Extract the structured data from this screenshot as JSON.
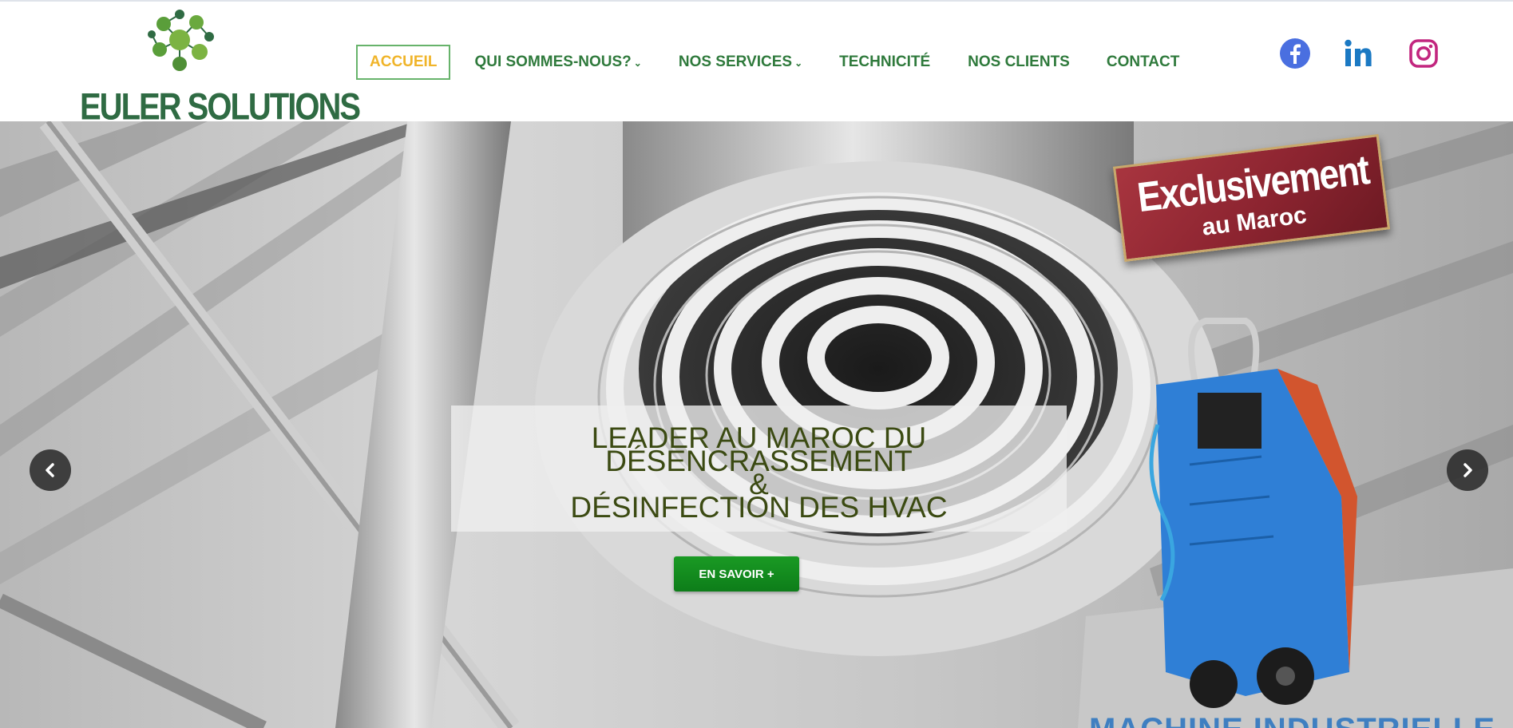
{
  "brand": {
    "name": "EULER SOLUTIONS",
    "color": "#2f6b43",
    "accent": "#f0b429"
  },
  "nav": {
    "items": [
      {
        "label": "ACCUEIL",
        "active": true
      },
      {
        "label": "QUI SOMMES-NOUS?",
        "has_dropdown": true
      },
      {
        "label": "NOS SERVICES",
        "has_dropdown": true
      },
      {
        "label": "TECHNICITÉ"
      },
      {
        "label": "NOS CLIENTS"
      },
      {
        "label": "CONTACT"
      }
    ],
    "caret_glyph": "⌄"
  },
  "social": [
    {
      "icon": "facebook-icon",
      "color": "#4a6fe0"
    },
    {
      "icon": "linkedin-icon",
      "color": "#1b79c3"
    },
    {
      "icon": "instagram-icon",
      "color": "#c2267f"
    }
  ],
  "hero": {
    "headline_line1": "LEADER AU MAROC DU DÉSENCRASSEMENT",
    "headline_line2": "&",
    "headline_line3": "DÉSINFECTION DES HVAC",
    "cta_label": "EN SAVOIR +",
    "badge_line1": "Exclusivement",
    "badge_line2": "au Maroc",
    "machine_label": "MACHINE INDUSTRIELLE",
    "prev_icon": "chevron-left-icon",
    "next_icon": "chevron-right-icon"
  }
}
